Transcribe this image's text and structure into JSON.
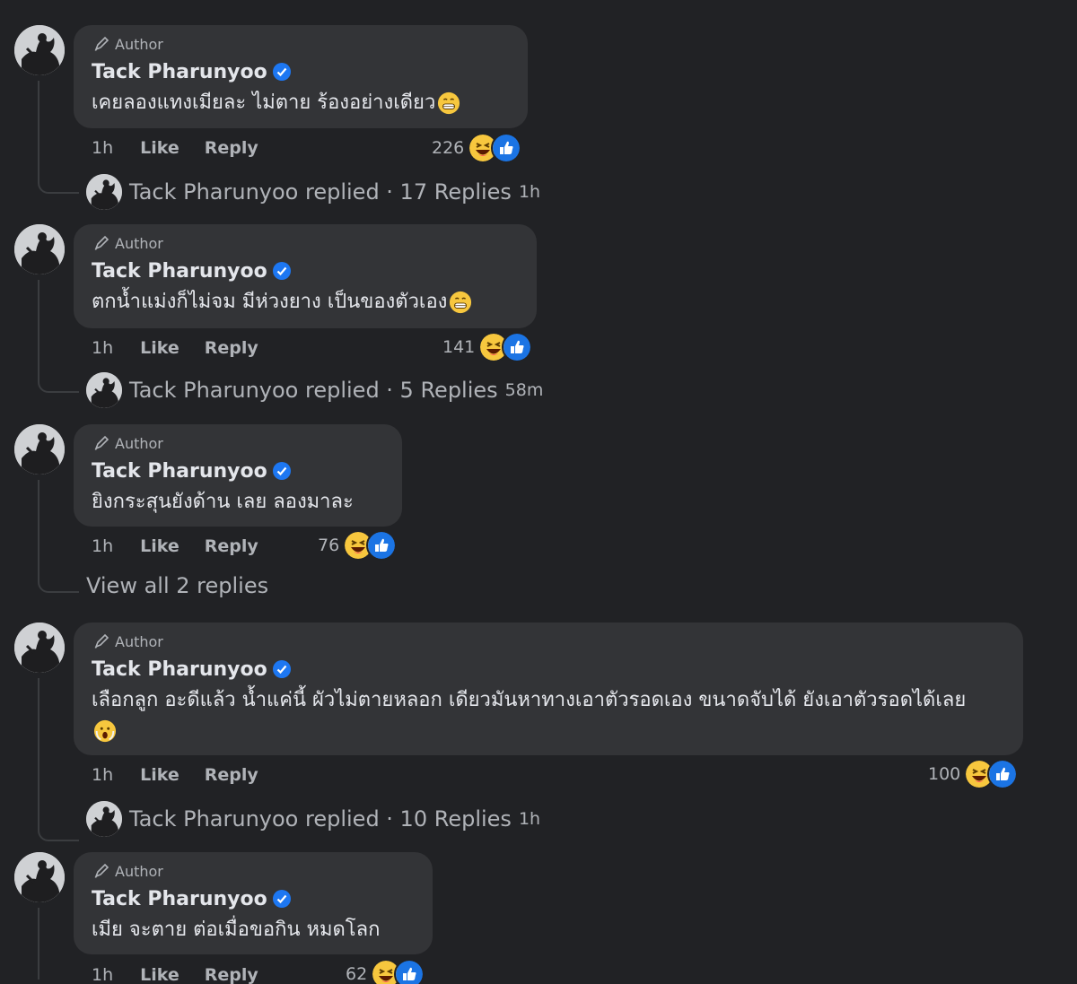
{
  "author_badge_label": "Author",
  "comments": [
    {
      "name": "Tack Pharunyoo",
      "text": "เคยลองแทงเมียละ ไม่ตาย ร้องอย่างเดียว",
      "time": "1h",
      "like_label": "Like",
      "reply_label": "Reply",
      "reaction_count": "226",
      "reply_summary": "Tack Pharunyoo replied · 17 Replies",
      "reply_time": "1h"
    },
    {
      "name": "Tack Pharunyoo",
      "text": "ตกน้ำแม่งก็ไม่จม มีห่วงยาง เป็นของตัวเอง",
      "time": "1h",
      "like_label": "Like",
      "reply_label": "Reply",
      "reaction_count": "141",
      "reply_summary": "Tack Pharunyoo replied · 5 Replies",
      "reply_time": "58m"
    },
    {
      "name": "Tack Pharunyoo",
      "text": "ยิงกระสุนยังด้าน เลย ลองมาละ",
      "time": "1h",
      "like_label": "Like",
      "reply_label": "Reply",
      "reaction_count": "76",
      "view_all": "View all 2 replies"
    },
    {
      "name": "Tack Pharunyoo",
      "text": "เลือกลูก อะดีแล้ว น้ำแค่นี้ ผัวไม่ตายหลอก เดียวมันหาทางเอาตัวรอดเอง ขนาดจับได้ ยังเอาตัวรอดได้เลย",
      "time": "1h",
      "like_label": "Like",
      "reply_label": "Reply",
      "reaction_count": "100",
      "reply_summary": "Tack Pharunyoo replied · 10 Replies",
      "reply_time": "1h"
    },
    {
      "name": "Tack Pharunyoo",
      "text": "เมีย จะตาย ต่อเมื่อขอกิน หมดโลก",
      "time": "1h",
      "like_label": "Like",
      "reply_label": "Reply",
      "reaction_count": "62"
    }
  ],
  "colors": {
    "background": "#212225",
    "bubble": "#333437",
    "verified_blue": "#1d77f2",
    "haha_yellow": "#f7c73e",
    "like_blue": "#1b74e4"
  }
}
